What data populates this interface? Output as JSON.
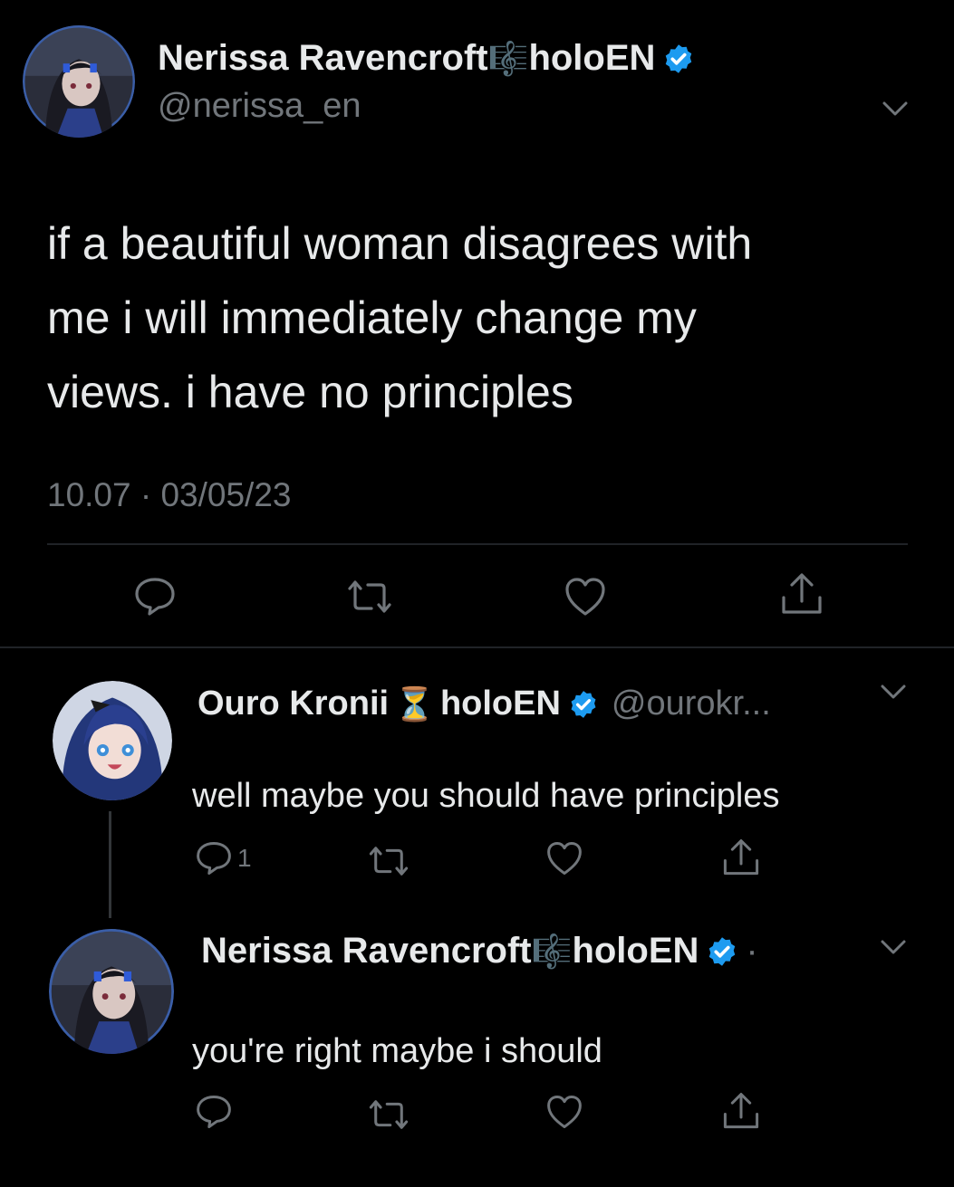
{
  "main_tweet": {
    "author_name": "Nerissa Ravencroft",
    "name_emoji": "🎼",
    "name_suffix": "holoEN",
    "handle": "@nerissa_en",
    "text_lines": [
      "if a beautiful woman disagrees with",
      "me i will immediately change my",
      "views. i have no principles"
    ],
    "timestamp": "10.07 · 03/05/23"
  },
  "replies": [
    {
      "author_name": "Ouro Kronii",
      "name_emoji": "⏳",
      "name_suffix": "holoEN",
      "handle": "@ourokr...",
      "text": "well maybe you should have principles",
      "reply_count": "1"
    },
    {
      "author_name": "Nerissa Ravencroft",
      "name_emoji": "🎼",
      "name_suffix": "holoEN",
      "dot": "·",
      "text": "you're right maybe i should",
      "reply_count": ""
    }
  ],
  "icons": {
    "reply": "reply-icon",
    "retweet": "retweet-icon",
    "like": "like-icon",
    "share": "share-icon",
    "verified": "verified-badge-icon",
    "more": "chevron-down-icon"
  },
  "colors": {
    "background": "#000000",
    "text_primary": "#e7e9ea",
    "text_secondary": "#71767b",
    "verified_blue": "#1d9bf0",
    "divider": "#202327"
  }
}
